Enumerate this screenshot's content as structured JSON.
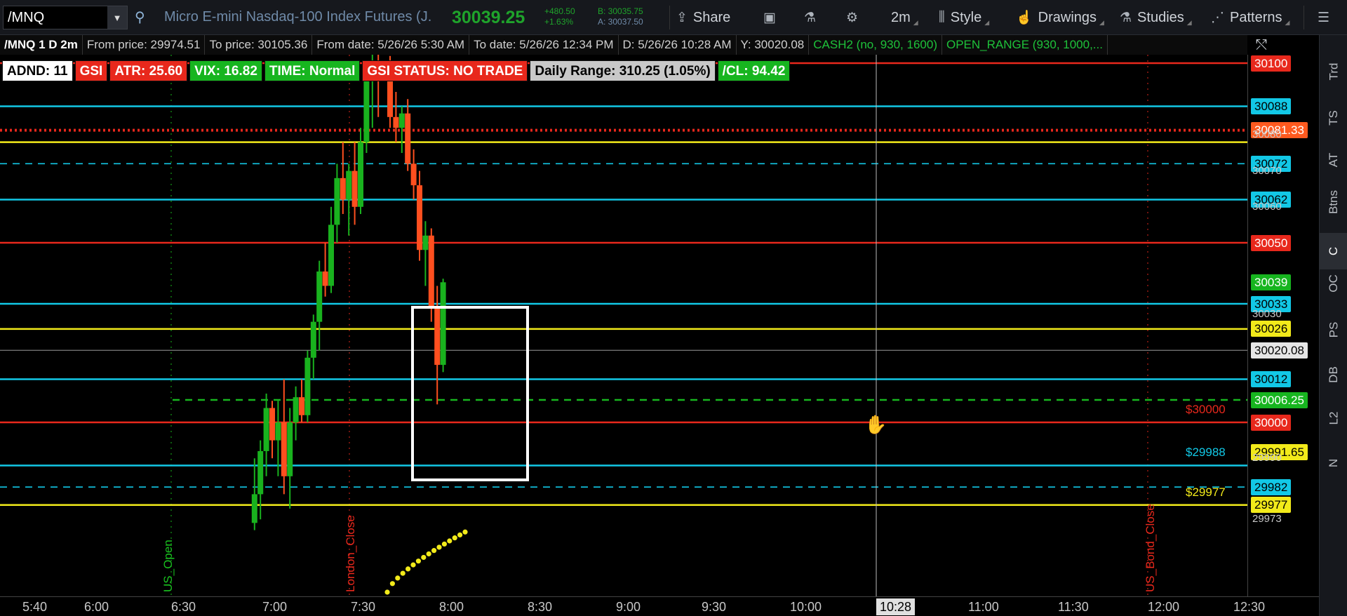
{
  "toolbar": {
    "symbol": "/MNQ",
    "description": "Micro E-mini Nasdaq-100 Index Futures (J...",
    "last_price": "30039.25",
    "net_change": "+480.50",
    "pct_change": "+1.63%",
    "bid": "B: 30035.75",
    "ask": "A: 30037.50",
    "share_label": "Share",
    "timeframe_label": "2m",
    "style_label": "Style",
    "drawings_label": "Drawings",
    "studies_label": "Studies",
    "patterns_label": "Patterns"
  },
  "info": {
    "chart_name": "/MNQ 1 D 2m",
    "from_price": "From price: 29974.51",
    "to_price": "To price: 30105.36",
    "from_date": "From date: 5/26/26 5:30 AM",
    "to_date": "To date: 5/26/26 12:34 PM",
    "cursor_date": "D: 5/26/26 10:28 AM",
    "cursor_y": "Y: 30020.08",
    "study1": "CASH2 (no, 930, 1600)",
    "study2": "OPEN_RANGE (930, 1000,..."
  },
  "badges": [
    {
      "text": "ADND: 11",
      "style": "white"
    },
    {
      "text": "GSI",
      "style": "red"
    },
    {
      "text": "ATR: 25.60",
      "style": "red"
    },
    {
      "text": "VIX: 16.82",
      "style": "green"
    },
    {
      "text": "TIME: Normal",
      "style": "green"
    },
    {
      "text": "GSI STATUS: NO TRADE",
      "style": "red"
    },
    {
      "text": "Daily Range: 310.25 (1.05%)",
      "style": "silver"
    },
    {
      "text": "/CL: 94.42",
      "style": "green"
    }
  ],
  "price_labels": [
    {
      "text": "30100",
      "bg": "#e8281c",
      "fg": "#ffffff"
    },
    {
      "text": "30088",
      "bg": "#12c8e6",
      "fg": "#000000"
    },
    {
      "text": "30081.33",
      "bg": "#ff5a1f",
      "fg": "#ffffff"
    },
    {
      "text": "30072",
      "bg": "#12c8e6",
      "fg": "#000000"
    },
    {
      "text": "30062",
      "bg": "#12c8e6",
      "fg": "#000000"
    },
    {
      "text": "30050",
      "bg": "#e8281c",
      "fg": "#ffffff"
    },
    {
      "text": "30039",
      "bg": "#17b51f",
      "fg": "#ffffff"
    },
    {
      "text": "30033",
      "bg": "#12c8e6",
      "fg": "#000000"
    },
    {
      "text": "30026",
      "bg": "#f2ea1a",
      "fg": "#000000"
    },
    {
      "text": "30020.08",
      "bg": "#e6e6e6",
      "fg": "#000000"
    },
    {
      "text": "30012",
      "bg": "#12c8e6",
      "fg": "#000000"
    },
    {
      "text": "30006.25",
      "bg": "#17b51f",
      "fg": "#ffffff"
    },
    {
      "text": "30000",
      "bg": "#e8281c",
      "fg": "#ffffff"
    },
    {
      "text": "29991.65",
      "bg": "#f2ea1a",
      "fg": "#000000"
    },
    {
      "text": "29982",
      "bg": "#12c8e6",
      "fg": "#000000"
    },
    {
      "text": "29977",
      "bg": "#f2ea1a",
      "fg": "#000000"
    }
  ],
  "axis_ticks": [
    "30080",
    "30070",
    "30060",
    "30030",
    "29990",
    "29973"
  ],
  "inline_labels": [
    {
      "text": "$30000",
      "color": "#e8281c"
    },
    {
      "text": "$29988",
      "color": "#12c8e6"
    },
    {
      "text": "$29977",
      "color": "#f2ea1a"
    }
  ],
  "session_labels": [
    {
      "text": "US_Open",
      "color": "#19c21f"
    },
    {
      "text": "London_Close",
      "color": "#e8281c"
    },
    {
      "text": "US_Bond_Close",
      "color": "#e8281c"
    }
  ],
  "time_ticks": [
    "5:40",
    "6:00",
    "6:30",
    "7:00",
    "7:30",
    "8:00",
    "8:30",
    "9:00",
    "9:30",
    "10:00",
    "11:00",
    "11:30",
    "12:00",
    "12:30"
  ],
  "cursor_time": "10:28",
  "side_tabs": [
    "Trd",
    "TS",
    "AT",
    "Btns",
    "C",
    "OC",
    "PS",
    "DB",
    "L2",
    "N"
  ],
  "colors": {
    "red": "#e8281c",
    "cyan": "#12c8e6",
    "yellow": "#f2ea1a",
    "green": "#17b51f",
    "orange": "#ff5a1f",
    "candle_up": "#19b21e",
    "candle_down": "#ff4f1f"
  },
  "chart_data": {
    "type": "candlestick",
    "symbol": "/MNQ",
    "timeframe": "2m",
    "y_range": [
      29972,
      30105
    ],
    "levels": [
      {
        "price": 30100,
        "color": "red",
        "style": "solid"
      },
      {
        "price": 30088,
        "color": "cyan",
        "style": "solid"
      },
      {
        "price": 30081.33,
        "color": "red",
        "style": "dotted"
      },
      {
        "price": 30078,
        "color": "yellow",
        "style": "solid"
      },
      {
        "price": 30072,
        "color": "cyan",
        "style": "dashed"
      },
      {
        "price": 30062,
        "color": "cyan",
        "style": "solid"
      },
      {
        "price": 30050,
        "color": "red",
        "style": "solid"
      },
      {
        "price": 30033,
        "color": "cyan",
        "style": "solid"
      },
      {
        "price": 30026,
        "color": "yellow",
        "style": "solid"
      },
      {
        "price": 30020.08,
        "color": "white",
        "style": "solid"
      },
      {
        "price": 30012,
        "color": "cyan",
        "style": "solid"
      },
      {
        "price": 30006.25,
        "color": "green",
        "style": "dashed"
      },
      {
        "price": 30000,
        "color": "red",
        "style": "solid"
      },
      {
        "price": 29988,
        "color": "cyan",
        "style": "solid"
      },
      {
        "price": 29982,
        "color": "cyan",
        "style": "dashed"
      },
      {
        "price": 29977,
        "color": "yellow",
        "style": "solid"
      }
    ],
    "candles": [
      {
        "t": "6:54",
        "o": 29972,
        "h": 29990,
        "l": 29970,
        "c": 29980
      },
      {
        "t": "6:56",
        "o": 29980,
        "h": 29995,
        "l": 29973,
        "c": 29992
      },
      {
        "t": "6:58",
        "o": 29992,
        "h": 30008,
        "l": 29985,
        "c": 30004
      },
      {
        "t": "7:00",
        "o": 30004,
        "h": 30006,
        "l": 29990,
        "c": 29995
      },
      {
        "t": "7:02",
        "o": 29995,
        "h": 30006,
        "l": 29985,
        "c": 30000
      },
      {
        "t": "7:04",
        "o": 30000,
        "h": 30012,
        "l": 29980,
        "c": 29985
      },
      {
        "t": "7:06",
        "o": 29985,
        "h": 30004,
        "l": 29976,
        "c": 30000
      },
      {
        "t": "7:08",
        "o": 30000,
        "h": 30010,
        "l": 29995,
        "c": 30007
      },
      {
        "t": "7:10",
        "o": 30007,
        "h": 30012,
        "l": 30000,
        "c": 30002
      },
      {
        "t": "7:12",
        "o": 30002,
        "h": 30020,
        "l": 30000,
        "c": 30018
      },
      {
        "t": "7:14",
        "o": 30018,
        "h": 30030,
        "l": 30012,
        "c": 30028
      },
      {
        "t": "7:16",
        "o": 30028,
        "h": 30045,
        "l": 30020,
        "c": 30042
      },
      {
        "t": "7:18",
        "o": 30042,
        "h": 30050,
        "l": 30035,
        "c": 30038
      },
      {
        "t": "7:20",
        "o": 30038,
        "h": 30060,
        "l": 30036,
        "c": 30055
      },
      {
        "t": "7:22",
        "o": 30055,
        "h": 30072,
        "l": 30050,
        "c": 30068
      },
      {
        "t": "7:24",
        "o": 30068,
        "h": 30078,
        "l": 30058,
        "c": 30062
      },
      {
        "t": "7:26",
        "o": 30062,
        "h": 30072,
        "l": 30052,
        "c": 30070
      },
      {
        "t": "7:28",
        "o": 30070,
        "h": 30078,
        "l": 30055,
        "c": 30060
      },
      {
        "t": "7:30",
        "o": 30060,
        "h": 30082,
        "l": 30058,
        "c": 30078
      },
      {
        "t": "7:32",
        "o": 30078,
        "h": 30098,
        "l": 30075,
        "c": 30095
      },
      {
        "t": "7:34",
        "o": 30095,
        "h": 30105,
        "l": 30082,
        "c": 30100
      },
      {
        "t": "7:36",
        "o": 30100,
        "h": 30104,
        "l": 30085,
        "c": 30098
      },
      {
        "t": "7:40",
        "o": 30098,
        "h": 30102,
        "l": 30082,
        "c": 30085
      },
      {
        "t": "7:42",
        "o": 30085,
        "h": 30092,
        "l": 30078,
        "c": 30082
      },
      {
        "t": "7:44",
        "o": 30082,
        "h": 30088,
        "l": 30075,
        "c": 30086
      },
      {
        "t": "7:46",
        "o": 30086,
        "h": 30090,
        "l": 30070,
        "c": 30072
      },
      {
        "t": "7:48",
        "o": 30072,
        "h": 30076,
        "l": 30062,
        "c": 30066
      },
      {
        "t": "7:50",
        "o": 30066,
        "h": 30070,
        "l": 30045,
        "c": 30048
      },
      {
        "t": "7:52",
        "o": 30048,
        "h": 30056,
        "l": 30038,
        "c": 30052
      },
      {
        "t": "7:54",
        "o": 30052,
        "h": 30054,
        "l": 30028,
        "c": 30032
      },
      {
        "t": "7:56",
        "o": 30032,
        "h": 30038,
        "l": 30005,
        "c": 30016
      },
      {
        "t": "7:58",
        "o": 30016,
        "h": 30040,
        "l": 30014,
        "c": 30039
      }
    ]
  }
}
